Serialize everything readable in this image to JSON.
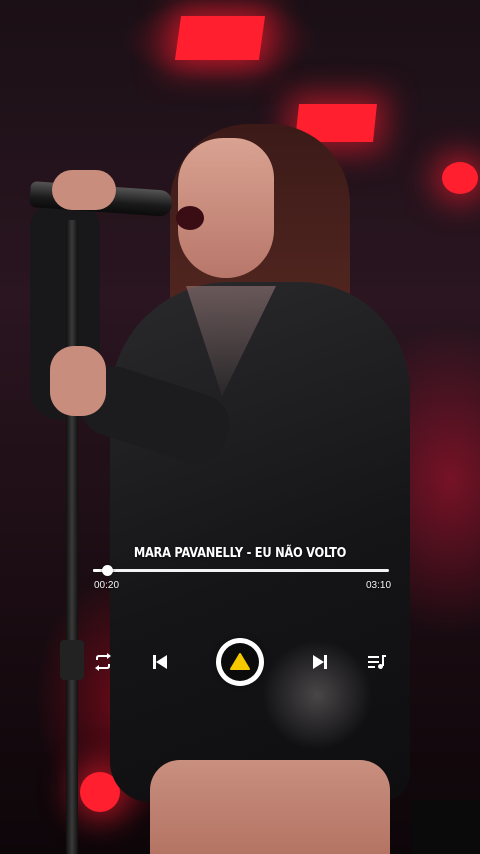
{
  "player": {
    "song_title": "MARA PAVANELLY - EU NÃO VOLTO",
    "elapsed_time": "00:20",
    "total_time": "03:10",
    "progress_fraction": 0.047,
    "accent_color": "#f5c800",
    "controls": {
      "repeat_icon": "repeat-icon",
      "previous_icon": "skip-previous-icon",
      "play_icon": "play-icon",
      "next_icon": "skip-next-icon",
      "playlist_icon": "playlist-music-icon"
    }
  }
}
